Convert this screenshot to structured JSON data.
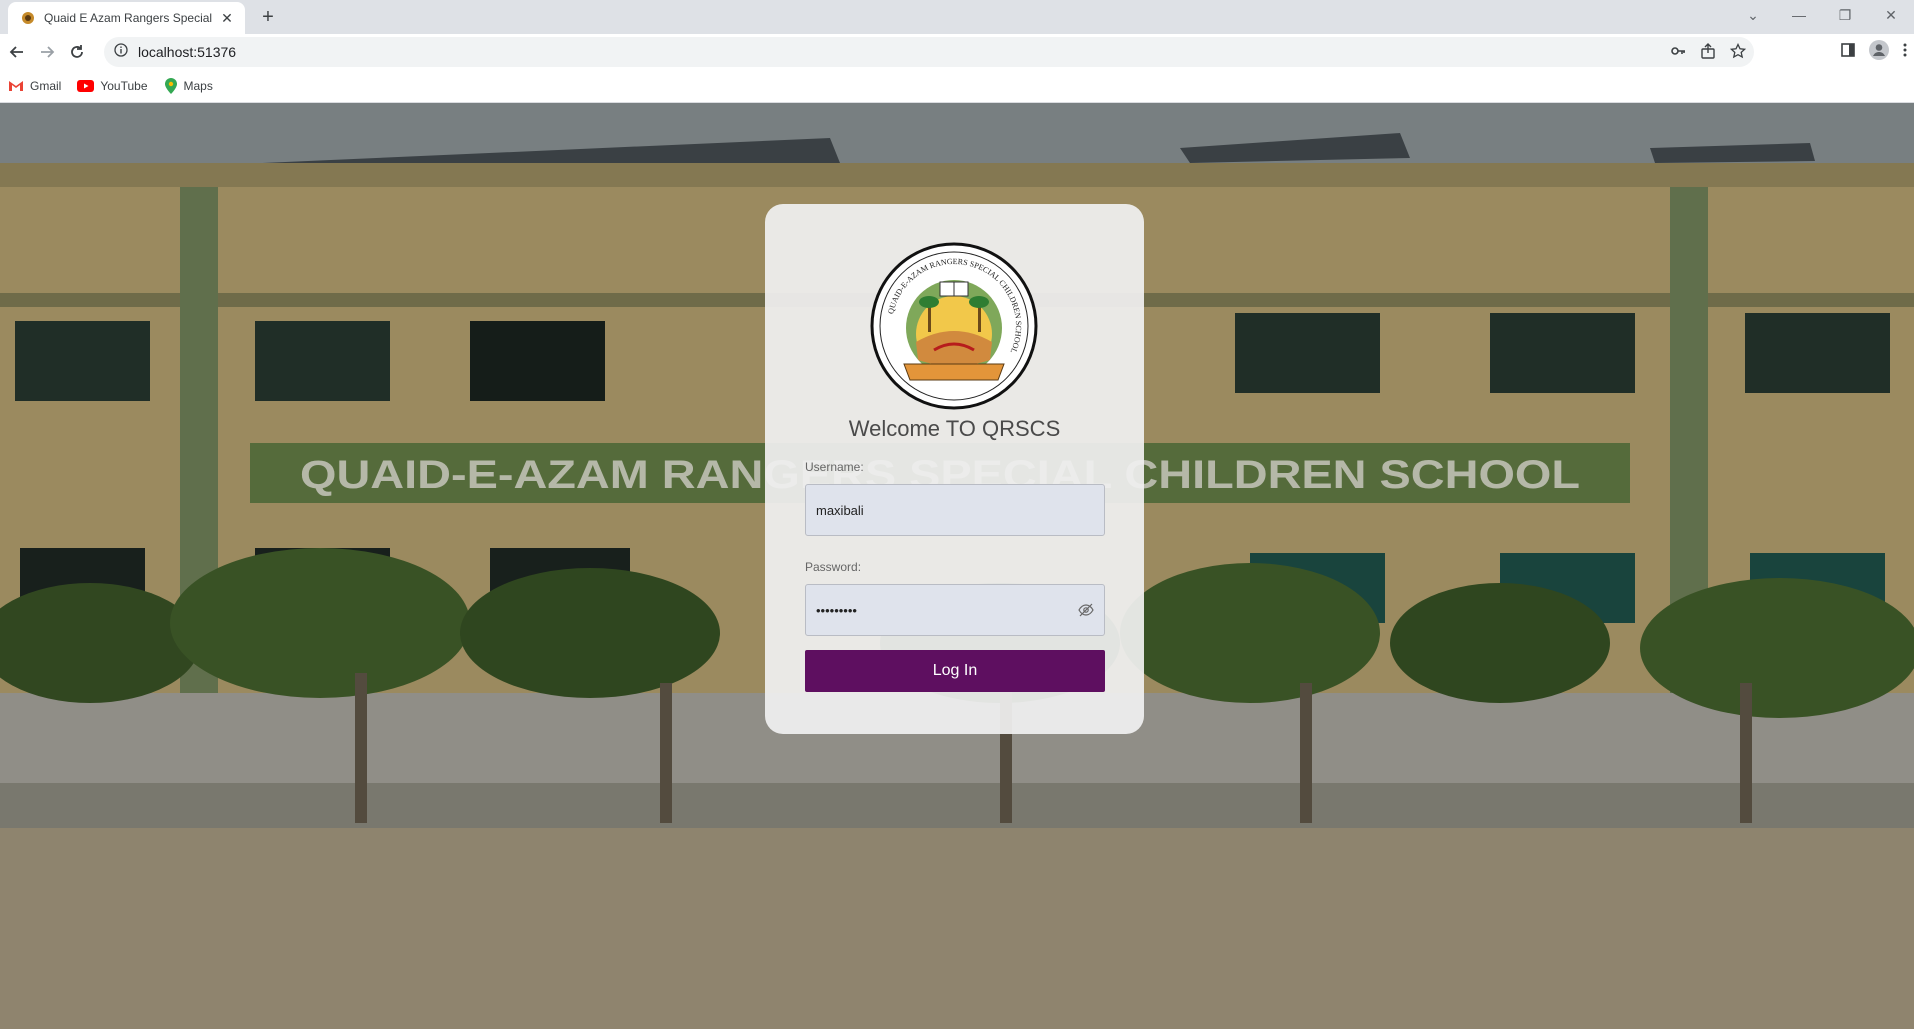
{
  "browser": {
    "tab_title": "Quaid E Azam Rangers Special C",
    "tab_close": "✕",
    "new_tab": "+",
    "url": "localhost:51376",
    "bookmarks": [
      {
        "label": "Gmail",
        "icon": "gmail-icon"
      },
      {
        "label": "YouTube",
        "icon": "youtube-icon"
      },
      {
        "label": "Maps",
        "icon": "maps-icon"
      }
    ]
  },
  "page": {
    "background_sign": "QUAID-E-AZAM RANGERS SPECIAL CHILDREN SCHOOL",
    "welcome": "Welcome TO QRSCS",
    "username_label": "Username:",
    "username_value": "maxibali",
    "password_label": "Password:",
    "password_value": "•••••••••",
    "login_label": "Log In",
    "logo_ring_text": "QUAID-E-AZAM RANGERS SPECIAL CHILDREN SCHOOL",
    "accent_color": "#5e0f60"
  }
}
